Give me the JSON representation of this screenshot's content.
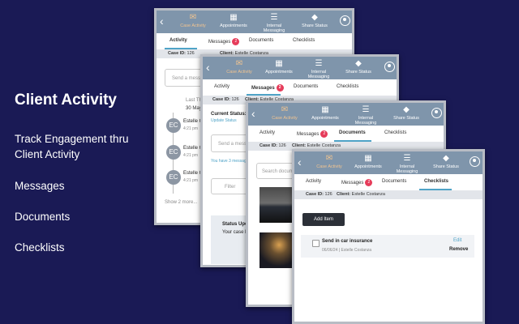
{
  "sidebar": {
    "title": "Client Activity",
    "items": [
      "Track Engagement thru Client Activity",
      "Messages",
      "Documents",
      "Checklists"
    ]
  },
  "nav": {
    "back": "‹",
    "items": [
      "Case Activity",
      "Appointments",
      "Internal Messaging",
      "Share Status"
    ]
  },
  "tabs": {
    "activity": "Activity",
    "messages": "Messages",
    "messages_badge": "2",
    "documents": "Documents",
    "checklists": "Checklists"
  },
  "case": {
    "id_label": "Case ID:",
    "id": "126",
    "client_label": "Client:",
    "client": "Estelle Costanza"
  },
  "screen1": {
    "send_placeholder": "Send a messa",
    "last_label": "Last Th",
    "date": "30 May",
    "entries": [
      {
        "initials": "EC",
        "name": "Estelle C",
        "time": "4:21 pm"
      },
      {
        "initials": "EC",
        "name": "Estelle C",
        "time": "4:21 pm"
      },
      {
        "initials": "EC",
        "name": "Estelle C",
        "time": "4:21 pm"
      }
    ],
    "show_more": "Show 2 more..."
  },
  "screen2": {
    "current_status": "Current Status:",
    "update_status": "Update Status",
    "send_placeholder": "Send a messa",
    "messages_note": "You have 3 messag",
    "filter": "Filter",
    "status_update_title": "Status Upd",
    "status_update_text": "Your case ha"
  },
  "screen3": {
    "search_placeholder": "Search docum"
  },
  "screen4": {
    "add_item": "Add Item",
    "checklist": {
      "title": "Send in car insurance",
      "meta": "06/06/24 | Estelle Costanza",
      "edit": "Edit",
      "remove": "Remove"
    }
  },
  "colors": {
    "background": "#1a1a55",
    "topbar": "#7f95ab",
    "accent": "#4fa3c7",
    "badge": "#e63c5a",
    "active_nav": "#f2c490"
  },
  "icons": [
    "back-chevron-icon",
    "mail-icon",
    "calendar-icon",
    "list-icon",
    "eraser-icon",
    "user-circle-icon"
  ]
}
